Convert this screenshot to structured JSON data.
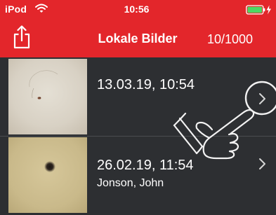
{
  "status_bar": {
    "carrier": "iPod",
    "time": "10:56",
    "battery_color": "#4cd964"
  },
  "nav_bar": {
    "share_icon": "share-icon",
    "title": "Lokale Bilder",
    "counter": "10/1000",
    "background": "#e3262b"
  },
  "images": [
    {
      "date": "13.03.19, 10:54",
      "name": "",
      "thumbnail": "skin-photo-light"
    },
    {
      "date": "26.02.19, 11:54",
      "name": "Jonson, John",
      "thumbnail": "skin-photo-dark-mole"
    }
  ],
  "overlay": {
    "icon": "tap-hand-icon"
  }
}
